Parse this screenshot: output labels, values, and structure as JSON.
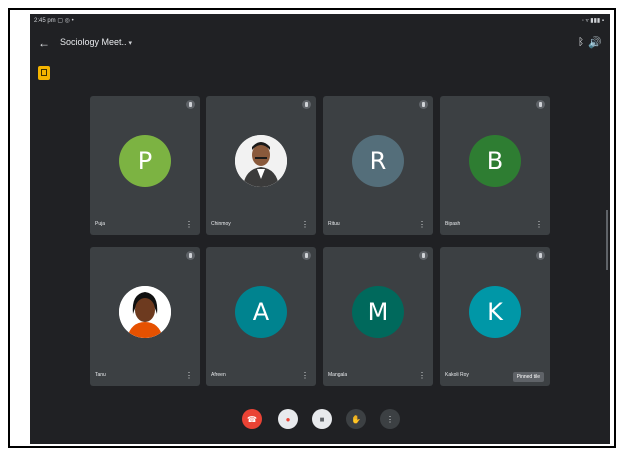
{
  "status_bar": {
    "left": "2:45 pm ▢ ◎ •",
    "right": "◦ ▿ ▮▮▮ ▪"
  },
  "header": {
    "title": "Sociology Meet..",
    "chevron": "▾"
  },
  "tiles": [
    {
      "initial": "P",
      "name": "Puja",
      "color": "#7cb342"
    },
    {
      "initial": "",
      "name": "Chinmoy",
      "color": "#ffffff"
    },
    {
      "initial": "R",
      "name": "Rituu",
      "color": "#546e7a"
    },
    {
      "initial": "B",
      "name": "Bipash",
      "color": "#2e7d32"
    },
    {
      "initial": "",
      "name": "Tanu",
      "color": "#ffffff"
    },
    {
      "initial": "A",
      "name": "Afreen",
      "color": "#00838f"
    },
    {
      "initial": "M",
      "name": "Mangala",
      "color": "#00695c"
    },
    {
      "initial": "K",
      "name": "Kakoli Roy",
      "color": "#0097a7"
    }
  ],
  "tooltip": "Pinned tile",
  "controls": {
    "end": "End call",
    "mic": "Mic",
    "camera": "Camera",
    "hand": "Raise hand",
    "more": "More"
  },
  "colors": {
    "background": "#202124",
    "tile": "#3c4043",
    "end_call": "#ea4335"
  }
}
